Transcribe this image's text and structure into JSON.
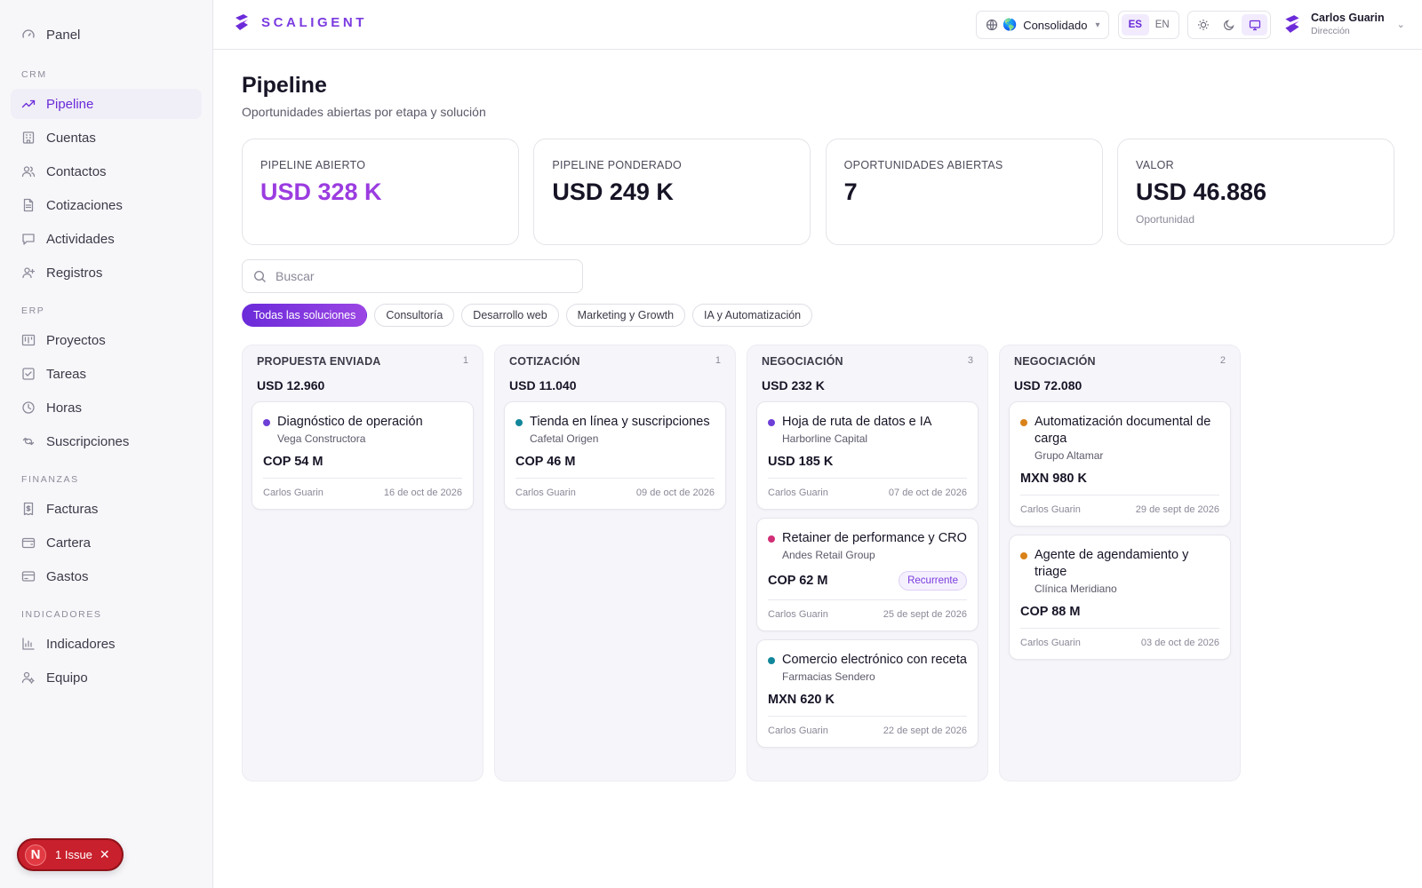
{
  "brand": {
    "name": "SCALIGENT",
    "accent": "#7a3be0"
  },
  "sidebar": {
    "top_item": {
      "label": "Panel",
      "icon": "gauge-icon"
    },
    "sections": [
      {
        "title": "CRM",
        "items": [
          {
            "label": "Pipeline",
            "icon": "trend-icon",
            "active": true
          },
          {
            "label": "Cuentas",
            "icon": "building-icon"
          },
          {
            "label": "Contactos",
            "icon": "users-icon"
          },
          {
            "label": "Cotizaciones",
            "icon": "document-icon"
          },
          {
            "label": "Actividades",
            "icon": "chat-icon"
          },
          {
            "label": "Registros",
            "icon": "user-plus-icon"
          }
        ]
      },
      {
        "title": "ERP",
        "items": [
          {
            "label": "Proyectos",
            "icon": "kanban-icon"
          },
          {
            "label": "Tareas",
            "icon": "checkbox-icon"
          },
          {
            "label": "Horas",
            "icon": "clock-icon"
          },
          {
            "label": "Suscripciones",
            "icon": "repeat-icon"
          }
        ]
      },
      {
        "title": "FINANZAS",
        "items": [
          {
            "label": "Facturas",
            "icon": "invoice-icon"
          },
          {
            "label": "Cartera",
            "icon": "wallet-icon"
          },
          {
            "label": "Gastos",
            "icon": "card-icon"
          }
        ]
      },
      {
        "title": "INDICADORES",
        "items": [
          {
            "label": "Indicadores",
            "icon": "bar-chart-icon"
          },
          {
            "label": "Equipo",
            "icon": "team-icon"
          }
        ]
      }
    ]
  },
  "issue_badge": {
    "letter": "N",
    "label": "1 Issue"
  },
  "topbar": {
    "entity_selector": {
      "value": "Consolidado",
      "flag": "🌎"
    },
    "languages": [
      "ES",
      "EN"
    ],
    "active_language": "ES",
    "user": {
      "name": "Carlos Guarin",
      "role": "Dirección"
    }
  },
  "page": {
    "title": "Pipeline",
    "subtitle": "Oportunidades abiertas por etapa y solución"
  },
  "kpis": [
    {
      "label": "PIPELINE ABIERTO",
      "value": "USD 328 K",
      "accent": true,
      "note": ""
    },
    {
      "label": "PIPELINE PONDERADO",
      "value": "USD 249 K",
      "accent": false,
      "note": ""
    },
    {
      "label": "OPORTUNIDADES ABIERTAS",
      "value": "7",
      "accent": false,
      "note": ""
    },
    {
      "label": "VALOR",
      "value": "USD 46.886",
      "accent": false,
      "note": "Oportunidad"
    }
  ],
  "search": {
    "placeholder": "Buscar",
    "value": ""
  },
  "filters": [
    {
      "label": "Todas las soluciones",
      "active": true
    },
    {
      "label": "Consultoría",
      "active": false
    },
    {
      "label": "Desarrollo web",
      "active": false
    },
    {
      "label": "Marketing y Growth",
      "active": false
    },
    {
      "label": "IA y Automatización",
      "active": false
    }
  ],
  "columns": [
    {
      "name": "PROPUESTA ENVIADA",
      "count": "1",
      "total": "USD 12.960",
      "cards": [
        {
          "title": "Diagnóstico de operación",
          "client": "Vega Constructora",
          "amount": "COP 54 M",
          "owner": "Carlos Guarin",
          "date": "16 de oct de 2026",
          "dot_color": "#6d3fd6",
          "badge": ""
        }
      ]
    },
    {
      "name": "COTIZACIÓN",
      "count": "1",
      "total": "USD 11.040",
      "cards": [
        {
          "title": "Tienda en línea y suscripciones",
          "client": "Cafetal Origen",
          "amount": "COP 46 M",
          "owner": "Carlos Guarin",
          "date": "09 de oct de 2026",
          "dot_color": "#12869a",
          "badge": ""
        }
      ]
    },
    {
      "name": "NEGOCIACIÓN",
      "count": "3",
      "total": "USD 232 K",
      "cards": [
        {
          "title": "Hoja de ruta de datos e IA",
          "client": "Harborline Capital",
          "amount": "USD 185 K",
          "owner": "Carlos Guarin",
          "date": "07 de oct de 2026",
          "dot_color": "#6d3fd6",
          "badge": ""
        },
        {
          "title": "Retainer de performance y CRO",
          "client": "Andes Retail Group",
          "amount": "COP 62 M",
          "owner": "Carlos Guarin",
          "date": "25 de sept de 2026",
          "dot_color": "#d02f76",
          "badge": "Recurrente"
        },
        {
          "title": "Comercio electrónico con receta",
          "client": "Farmacias Sendero",
          "amount": "MXN 620 K",
          "owner": "Carlos Guarin",
          "date": "22 de sept de 2026",
          "dot_color": "#12869a",
          "badge": ""
        }
      ]
    },
    {
      "name": "NEGOCIACIÓN",
      "count": "2",
      "total": "USD 72.080",
      "cards": [
        {
          "title": "Automatización documental de carga",
          "client": "Grupo Altamar",
          "amount": "MXN 980 K",
          "owner": "Carlos Guarin",
          "date": "29 de sept de 2026",
          "dot_color": "#d9821a",
          "badge": ""
        },
        {
          "title": "Agente de agendamiento y triage",
          "client": "Clínica Meridiano",
          "amount": "COP 88 M",
          "owner": "Carlos Guarin",
          "date": "03 de oct de 2026",
          "dot_color": "#d9821a",
          "badge": ""
        }
      ]
    }
  ]
}
